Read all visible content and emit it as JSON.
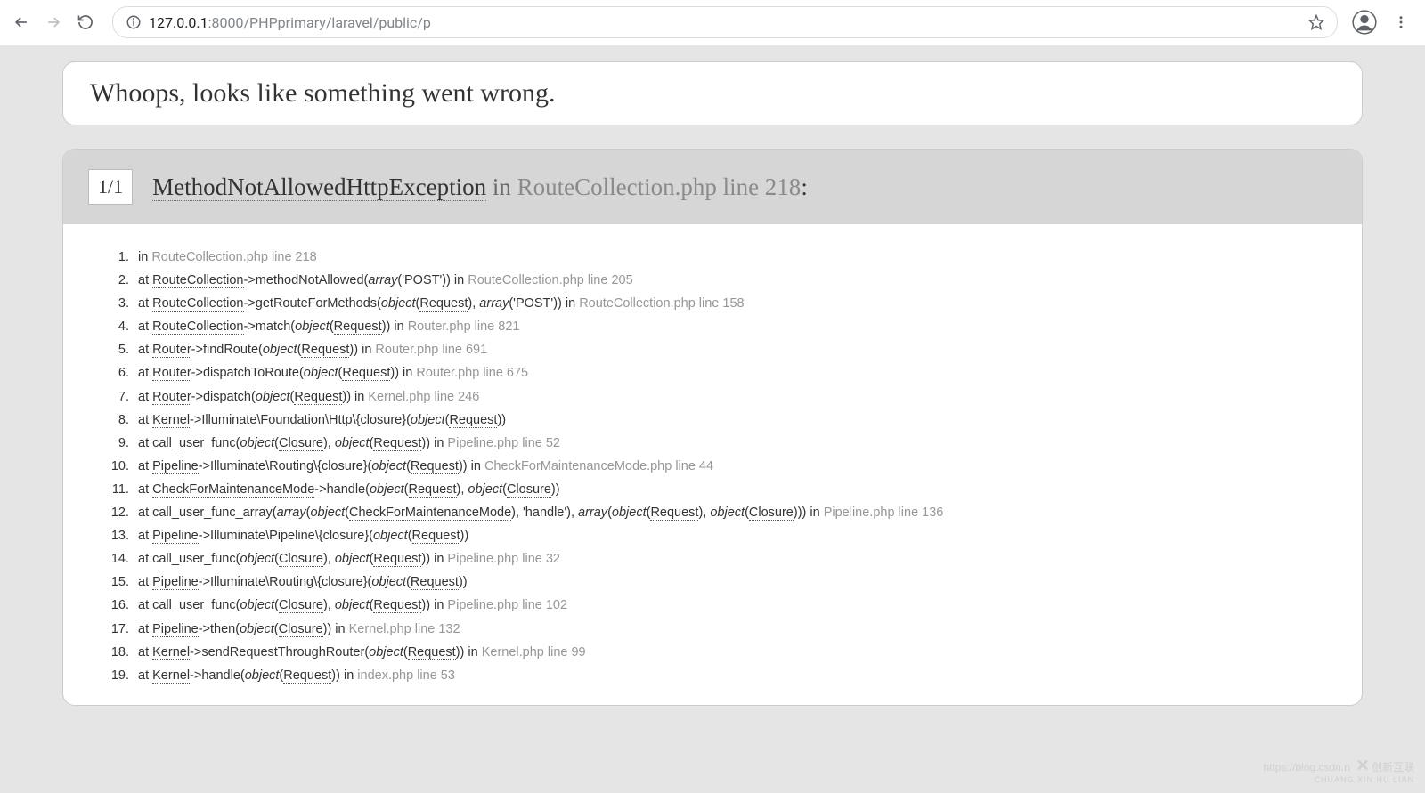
{
  "browser": {
    "url_host": "127.0.0.1",
    "url_port": ":8000",
    "url_path": "/PHPprimary/laravel/public/p"
  },
  "whoops": {
    "title": "Whoops, looks like something went wrong."
  },
  "exception": {
    "counter": "1/1",
    "class": "MethodNotAllowedHttpException",
    "in_word": " in ",
    "location": "RouteCollection.php line 218",
    "colon": ":"
  },
  "trace": [
    {
      "raw": "in <loc>RouteCollection.php line 218</loc>"
    },
    {
      "raw": "at <abbr>RouteCollection</abbr>->methodNotAllowed(<it>array</it>('POST')) in <loc>RouteCollection.php line 205</loc>"
    },
    {
      "raw": "at <abbr>RouteCollection</abbr>->getRouteForMethods(<it>object</it>(<abbr>Request</abbr>), <it>array</it>('POST')) in <loc>RouteCollection.php line 158</loc>"
    },
    {
      "raw": "at <abbr>RouteCollection</abbr>->match(<it>object</it>(<abbr>Request</abbr>)) in <loc>Router.php line 821</loc>"
    },
    {
      "raw": "at <abbr>Router</abbr>->findRoute(<it>object</it>(<abbr>Request</abbr>)) in <loc>Router.php line 691</loc>"
    },
    {
      "raw": "at <abbr>Router</abbr>->dispatchToRoute(<it>object</it>(<abbr>Request</abbr>)) in <loc>Router.php line 675</loc>"
    },
    {
      "raw": "at <abbr>Router</abbr>->dispatch(<it>object</it>(<abbr>Request</abbr>)) in <loc>Kernel.php line 246</loc>"
    },
    {
      "raw": "at <abbr>Kernel</abbr>->Illuminate\\\\Foundation\\\\Http\\\\{closure}(<it>object</it>(<abbr>Request</abbr>))"
    },
    {
      "raw": "at call_user_func(<it>object</it>(<abbr>Closure</abbr>), <it>object</it>(<abbr>Request</abbr>)) in <loc>Pipeline.php line 52</loc>"
    },
    {
      "raw": "at <abbr>Pipeline</abbr>->Illuminate\\\\Routing\\\\{closure}(<it>object</it>(<abbr>Request</abbr>)) in <loc>CheckForMaintenanceMode.php line 44</loc>"
    },
    {
      "raw": "at <abbr>CheckForMaintenanceMode</abbr>->handle(<it>object</it>(<abbr>Request</abbr>), <it>object</it>(<abbr>Closure</abbr>))"
    },
    {
      "raw": "at call_user_func_array(<it>array</it>(<it>object</it>(<abbr>CheckForMaintenanceMode</abbr>), 'handle'), <it>array</it>(<it>object</it>(<abbr>Request</abbr>), <it>object</it>(<abbr>Closure</abbr>))) in <loc>Pipeline.php line 136</loc>"
    },
    {
      "raw": "at <abbr>Pipeline</abbr>->Illuminate\\\\Pipeline\\\\{closure}(<it>object</it>(<abbr>Request</abbr>))"
    },
    {
      "raw": "at call_user_func(<it>object</it>(<abbr>Closure</abbr>), <it>object</it>(<abbr>Request</abbr>)) in <loc>Pipeline.php line 32</loc>"
    },
    {
      "raw": "at <abbr>Pipeline</abbr>->Illuminate\\\\Routing\\\\{closure}(<it>object</it>(<abbr>Request</abbr>))"
    },
    {
      "raw": "at call_user_func(<it>object</it>(<abbr>Closure</abbr>), <it>object</it>(<abbr>Request</abbr>)) in <loc>Pipeline.php line 102</loc>"
    },
    {
      "raw": "at <abbr>Pipeline</abbr>->then(<it>object</it>(<abbr>Closure</abbr>)) in <loc>Kernel.php line 132</loc>"
    },
    {
      "raw": "at <abbr>Kernel</abbr>->sendRequestThroughRouter(<it>object</it>(<abbr>Request</abbr>)) in <loc>Kernel.php line 99</loc>"
    },
    {
      "raw": "at <abbr>Kernel</abbr>->handle(<it>object</it>(<abbr>Request</abbr>)) in <loc>index.php line 53</loc>"
    }
  ],
  "watermark": {
    "url": "https://blog.csdn.n",
    "brand": "创新互联"
  }
}
